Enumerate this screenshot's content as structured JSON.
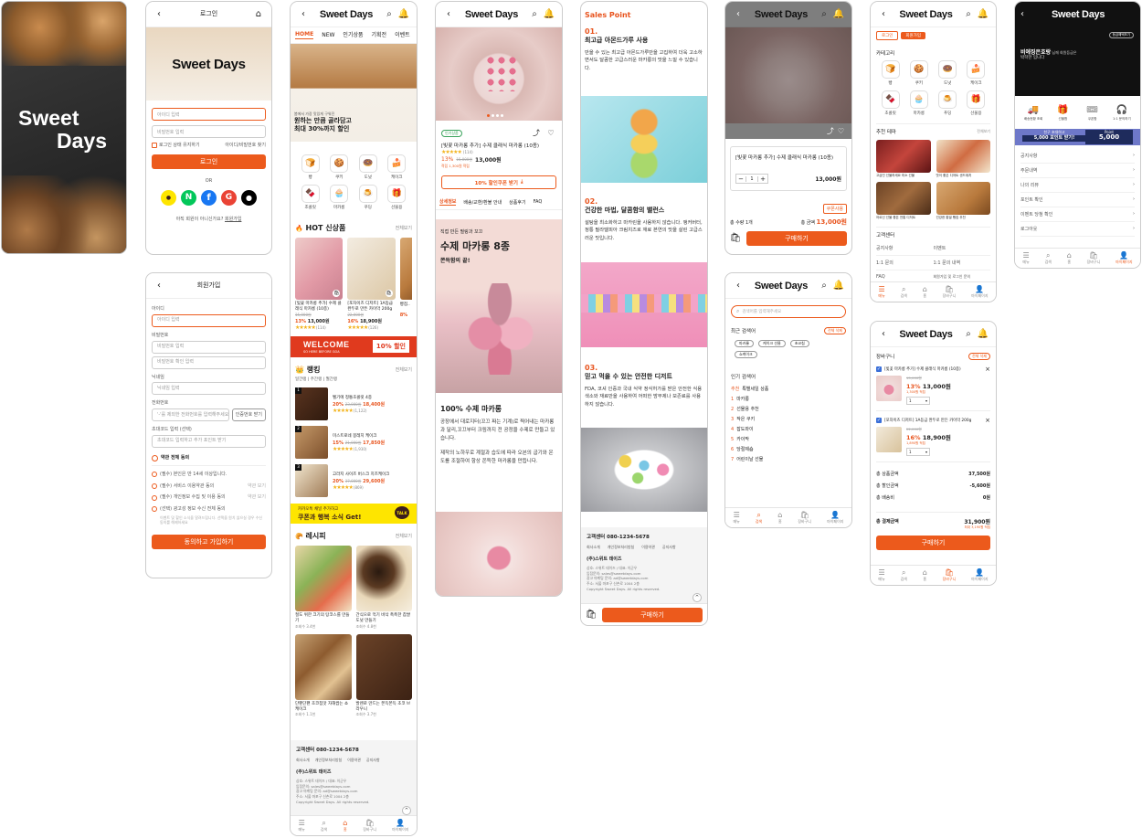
{
  "brand": "Sweet Days",
  "splash": {
    "line1": "Sweet",
    "line2": "Days"
  },
  "login": {
    "title": "로그인",
    "id_ph": "아이디 입력",
    "pw_ph": "비밀번호 입력",
    "keep": "로그인 상태 유지하기",
    "find": "아이디/비밀번호 찾기",
    "btn": "로그인",
    "or": "OR",
    "no_member": "아직 회원이 아니신가요?",
    "join": "회원가입"
  },
  "signup": {
    "title": "회원가입",
    "id_l": "아이디",
    "id_ph": "아이디 입력",
    "pw_l": "비밀번호",
    "pw_ph": "비밀번호 입력",
    "pw2_ph": "비밀번호 확인 입력",
    "nick_l": "닉네임",
    "nick_ph": "닉네임 입력",
    "tel_l": "전화번호",
    "tel_ph": "'-'를 제외한 전화번호를 입력해주세요",
    "tel_btn": "인증번호 받기",
    "ref_l": "초대코드 입력 (선택)",
    "ref_ph": "초대코드 입력하고 추가 포인트 받기",
    "agree_all": "약관 전체 동의",
    "agrees": [
      "(필수) 본인은 만 14세 이상입니다.",
      "(필수) 서비스 이용약관 동의",
      "(필수) 개인정보 수집 및 이용 동의",
      "(선택) 광고성 정보 수신 전체 동의"
    ],
    "view": "약관 보기",
    "ad_note": "이벤트 및 할인 소식을 알려드립니다. 선택을 원치 않으실 경우 수신 동의를 해제하세요",
    "btn": "동의하고 가입하기"
  },
  "home": {
    "tabs": [
      "HOME",
      "NEW",
      "인기상품",
      "기획전",
      "이벤트"
    ],
    "hero_small": "봄에서 가장 맛있게 구워진",
    "hero_big1": "원하는 만큼 골라담고",
    "hero_big2": "최대 30%까지 할인",
    "cats": [
      {
        "l": "빵",
        "i": "bread-icon",
        "g": "🍞"
      },
      {
        "l": "쿠키",
        "i": "cookie-icon",
        "g": "🍪"
      },
      {
        "l": "도넛",
        "i": "donut-icon",
        "g": "🍩"
      },
      {
        "l": "케이크",
        "i": "cake-icon",
        "g": "🍰"
      },
      {
        "l": "조콜릿",
        "i": "chocolate-icon",
        "g": "🍫"
      },
      {
        "l": "마카롱",
        "i": "macaron-icon",
        "g": "🧁"
      },
      {
        "l": "푸딩",
        "i": "pudding-icon",
        "g": "🍮"
      },
      {
        "l": "선물용",
        "i": "gift-icon",
        "g": "🎁"
      }
    ],
    "hot": "HOT 신상품",
    "more": "전체보기",
    "hot_items": [
      {
        "name": "[빛꽃 마카롱 추가] 수제 클래식 마카롱 (10종)",
        "orig": "15,000원",
        "disc": "13%",
        "price": "13,000원",
        "rev": "(114)"
      },
      {
        "name": "[포차이즈 디저트] 1A등급 완두로 만든 카이막 200g",
        "orig": "22,000원",
        "disc": "16%",
        "price": "18,900원",
        "rev": "(126)"
      },
      {
        "name": "빵점..",
        "orig": "",
        "disc": "8%",
        "price": "",
        "rev": ""
      }
    ],
    "welcome": "WELCOME",
    "welcome_sub": "SO HERE BEFORE GOA",
    "welcome_pct": "10% 할인",
    "rank": "랭킹",
    "rank_tabs": "일간랭 | 주간랭 | 월간랭",
    "rank_items": [
      {
        "n": "1",
        "name": "벨기에 정통초콜릿 4종",
        "pct": "20%",
        "orig": "23,000원",
        "price": "18,400원",
        "rev": "(1,122)"
      },
      {
        "n": "2",
        "name": "미스트로네 봉레치 케이크",
        "pct": "15%",
        "orig": "21,000원",
        "price": "17,850원",
        "rev": "(1,930)"
      },
      {
        "n": "3",
        "name": "고라지 사이즈 버스크 치즈케이크",
        "pct": "20%",
        "orig": "37,000원",
        "price": "29,600원",
        "rev": "(869)"
      }
    ],
    "kakao1": "카카오톡 채널 추가하고",
    "kakao2": "쿠폰과 행복 소식 Get!",
    "kakao_talk": "TALK",
    "recipe": "레시피",
    "recipes": [
      {
        "t": "절도 위한 크기의 탕코스를 만들기",
        "c": "조회수 3.4천"
      },
      {
        "t": "간식으로 먹기 바삭 촉촉한 찹쌀도넛 만들기",
        "c": "조회수 4.8천"
      },
      {
        "t": "단팬단팬 초코칩맛 자해쌉는 쇼케이크",
        "c": "조회수 1.1천"
      },
      {
        "t": "발렌로 만드는 쫀득쫀득 초코 브라우니",
        "c": "조회수 3.7천"
      }
    ]
  },
  "footer": {
    "cs": "고객센터 080-1234-5678",
    "links": [
      "회사소개",
      "개인정보처리방침",
      "이용약관",
      "공지사항"
    ],
    "company": "(주)스위트 데이즈",
    "info": [
      "상호: 스위트 데이즈 / 대표: 이군우",
      "입점문의: sales@sweetdays.com",
      "광고 마케팅 문의: ad@sweetdays.com",
      "주소: 서울 마포구 신촌로 1004 2층",
      "Copyright Sweet Days. All rights reserved."
    ]
  },
  "bnav": [
    {
      "l": "메뉴",
      "i": "menu-icon",
      "g": "☰"
    },
    {
      "l": "검색",
      "i": "search-icon",
      "g": "⌕"
    },
    {
      "l": "홈",
      "i": "home-icon",
      "g": "⌂"
    },
    {
      "l": "장바구니",
      "i": "cart-icon",
      "g": "🛍"
    },
    {
      "l": "마이페이지",
      "i": "user-icon",
      "g": "👤"
    }
  ],
  "detail": {
    "badge": "인기상품",
    "name": "[빛꽃 마카롱 추가] 수제 클래식 마카롱 (10종)",
    "rev": "(114)",
    "disc": "13%",
    "orig": "15,000원",
    "price": "13,000원",
    "point": "적립 1,300원 적립",
    "coupon": "10% 할인쿠폰 받기",
    "tabs": [
      "상세정보",
      "배송/교환/환불 안내",
      "상품후기",
      "FAQ"
    ],
    "hero_small": "직접 만든 필링과 꼬끄",
    "hero_big": "수제 마카롱 8종",
    "hero_sub": "쫀득함의 끝!",
    "title": "100% 수제 마카롱",
    "p1": "공장에서 대로지터(꼬끄 짜는 기계)로 찍어내는 마카롱과 달리,꼬끄부터 크림까지 전 공정을 수제로 만들고 있습니다.",
    "p2": "제작의 노하우로 계절과 습도에 따라 오븐의 굽기와 온도를 조절하여 항상 쫀득한 마카롱을 만듭니다."
  },
  "sales": {
    "head": "Sales Point",
    "points": [
      {
        "n": "01.",
        "t": "최고급 아몬드가루 사용",
        "d": "만을 수 있는 최고급 아몬드가루만을 고집하여 더욱 고소하면서도 달콤한 고급스러운 마카롱의 맛을 느낄 수 있습니다."
      },
      {
        "n": "02.",
        "t": "건강한 마법, 달콤함의 밸런스",
        "d": "설탕을 최소화하고 마카린을 사용하지 않습니다. 앵커버터, 정통 필라델피아 크림치즈로 재료 본연의 맛을 살린 고급스러운 맛입니다."
      },
      {
        "n": "03.",
        "t": "믿고 먹을 수 있는 안전한 디저트",
        "d": "FDA, 코셔 인증과 국내 식약 정식허가를 받은 안전한 식용색소와 재료만을 사용하여 어떠한 방부제나 보존료를 사용하지 않습니다."
      }
    ],
    "buy": "구매하기"
  },
  "option": {
    "name": "[빛꽃 마카롱 추가] 수제 클래식 마카롱 (10종)",
    "qty": "1",
    "line_price": "13,000원",
    "coupon": "쿠폰사용",
    "total_qty": "총 수량 1개",
    "total_label": "총 금액",
    "total": "13,000원",
    "buy": "구매하기"
  },
  "search": {
    "ph": "검색어를 입력해주세요",
    "recent": "최근 검색어",
    "del_all": "전체 삭제",
    "recent_chips": [
      "마카롱",
      "케이크 선물",
      "초코칩",
      "쇼케이크"
    ],
    "popular": "인기 검색어",
    "pop_items": [
      {
        "n": "추천",
        "t": "특별세일 상품"
      },
      {
        "n": "1",
        "t": "마카롱"
      },
      {
        "n": "2",
        "t": "선물용 추천"
      },
      {
        "n": "3",
        "t": "작은 쿠키"
      },
      {
        "n": "4",
        "t": "잡도와이"
      },
      {
        "n": "5",
        "t": "카이막"
      },
      {
        "n": "6",
        "t": "당절제숍"
      },
      {
        "n": "7",
        "t": "어린이날 선물"
      }
    ]
  },
  "menu": {
    "login": "로그인",
    "join": "회원가입",
    "cat": "카테고리",
    "cats": [
      {
        "l": "빵",
        "i": "bread-icon",
        "g": "🍞"
      },
      {
        "l": "쿠키",
        "i": "cookie-icon",
        "g": "🍪"
      },
      {
        "l": "도넛",
        "i": "donut-icon",
        "g": "🍩"
      },
      {
        "l": "케이크",
        "i": "cake-icon",
        "g": "🍰"
      },
      {
        "l": "초콜릿",
        "i": "chocolate-icon",
        "g": "🍫"
      },
      {
        "l": "마카롱",
        "i": "macaron-icon",
        "g": "🧁"
      },
      {
        "l": "푸딩",
        "i": "pudding-icon",
        "g": "🍮"
      },
      {
        "l": "선물용",
        "i": "gift-icon",
        "g": "🎁"
      }
    ],
    "theme": "추천 테마",
    "theme_more": "전체보기",
    "themes": [
      "고급진 선물하세요 미소 선물",
      "맛이 좋은 디저트 샌드위치",
      "어르신 선물 좋은 전통 디저트",
      "건강한 통밀 빵집 추천"
    ],
    "cs": "고객센터",
    "cs_links": [
      "공지사항",
      "이벤트",
      "1:1 문의",
      "1:1 문의 내역",
      "FAQ",
      "회원가입 및 로그인 문의"
    ]
  },
  "cart": {
    "title": "장바구니",
    "del": "전체 삭제",
    "items": [
      {
        "name": "[빛꽃 마카롱 추가] 수제 클래식 마카롱 (10종)",
        "orig": "15,000원",
        "disc": "13%",
        "price": "13,000원",
        "pt": "1,300원 적립",
        "qty": "1"
      },
      {
        "name": "[포차이즈 디저트] 1A등급 완두로 만든 카이막 200g",
        "orig": "22,000원",
        "disc": "16%",
        "price": "18,900원",
        "pt": "1,890원 적립",
        "qty": "1"
      }
    ],
    "rows": [
      {
        "l": "총 상품금액",
        "v": "37,500원"
      },
      {
        "l": "총 할인금액",
        "v": "-5,600원"
      },
      {
        "l": "총 배송비",
        "v": "0원"
      }
    ],
    "total_l": "총 결제금액",
    "total": "31,900원",
    "total_pt": "최대 3,190원 적립",
    "buy": "구매하기"
  },
  "mypage": {
    "grade_badge": "등급혜택보기",
    "name": "비에징은호랑",
    "greet": "님께 회원등급은",
    "grade": "박학한 입니다",
    "icons": [
      {
        "l": "배송현황 조회",
        "i": "truck-icon",
        "g": "🚚"
      },
      {
        "l": "선물함",
        "i": "gift-icon",
        "g": "🎁"
      },
      {
        "l": "쿠폰함",
        "i": "coupon-icon",
        "g": "🎟"
      },
      {
        "l": "1:1 문의하기",
        "i": "headset-icon",
        "g": "🎧"
      }
    ],
    "banner_top": "친구 초대하고",
    "banner_main": "5,000 포인트 받기!",
    "point_l": "Point",
    "point": "5,000",
    "links": [
      "공지사항",
      "주문내역",
      "나의 리뷰",
      "포인트 확인",
      "이벤트 당첨 확인",
      "로그아웃"
    ]
  },
  "colors": {
    "accent": "#EC5A1C",
    "kakao": "#FEE500",
    "star": "#F3B31B",
    "navy": "#1E2B5C"
  }
}
